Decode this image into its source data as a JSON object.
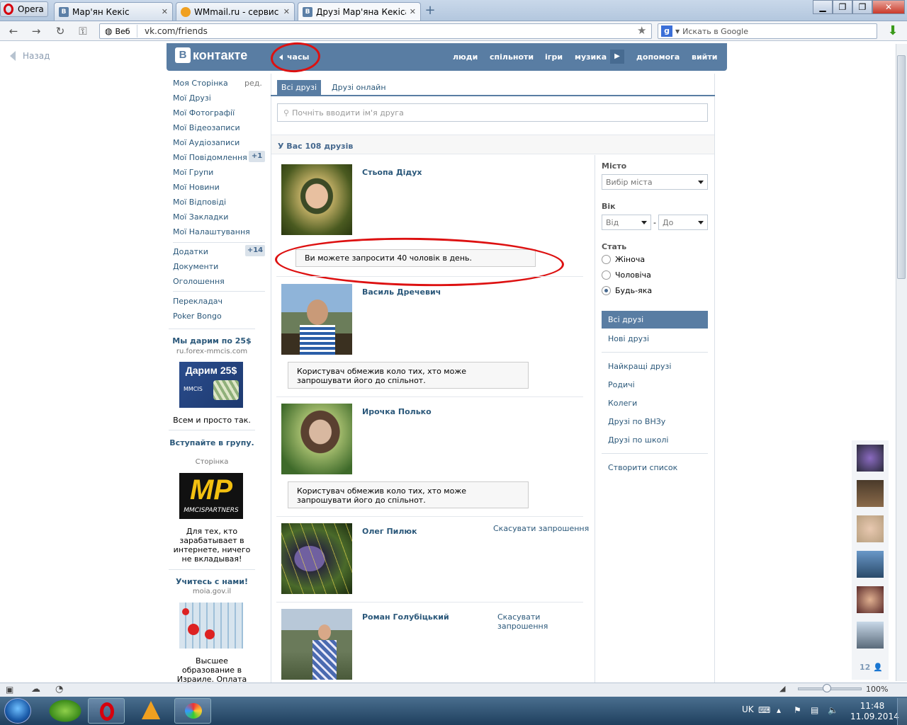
{
  "browser": {
    "menu_label": "Opera",
    "tabs": [
      {
        "label": "Мар'ян Кекіс",
        "favicon": "vk-icon"
      },
      {
        "label": "WMmail.ru - сервис п...",
        "favicon": "wmmail-icon"
      },
      {
        "label": "Друзі Мар'яна Кекіса |...",
        "favicon": "vk-icon",
        "active": true
      }
    ],
    "address_chip": "Веб",
    "url": "vk.com/friends",
    "search_placeholder": "Искать в Google",
    "zoom": "100%"
  },
  "page": {
    "back_label": "Назад",
    "logo_text": "контакте",
    "logo_letter": "В",
    "clock_label": "часы",
    "top_nav": [
      "люди",
      "спільноти",
      "ігри",
      "музика",
      "допомога",
      "вийти"
    ],
    "left_menu": [
      {
        "label": "Моя Сторінка"
      },
      {
        "label": "Мої Друзі"
      },
      {
        "label": "Мої Фотографії"
      },
      {
        "label": "Мої Відеозаписи"
      },
      {
        "label": "Мої Аудіозаписи"
      },
      {
        "label": "Мої Повідомлення",
        "badge": "+1"
      },
      {
        "label": "Мої Групи"
      },
      {
        "label": "Мої Новини"
      },
      {
        "label": "Мої Відповіді"
      },
      {
        "label": "Мої Закладки"
      },
      {
        "label": "Мої Налаштування"
      }
    ],
    "edit_label": "ред.",
    "left_menu2": [
      {
        "label": "Додатки",
        "badge": "+14"
      },
      {
        "label": "Документи"
      },
      {
        "label": "Оголошення"
      }
    ],
    "left_menu3": [
      "Перекладач",
      "Poker Bongo"
    ],
    "ads": [
      {
        "title": "Мы дарим по 25$",
        "sub": "ru.forex-mmcis.com",
        "img_text": "Дарим 25$",
        "img_sub": "MMCIS",
        "text": "Всем и просто так."
      },
      {
        "title": "Вступайте в групу.",
        "sub": "Сторінка",
        "img_text": "MP",
        "img_sub": "MMCISPARTNERS",
        "text": "Для тех, кто зарабатывает в интернете, ничего не вкладывая!"
      },
      {
        "title": "Учитесь с нами!",
        "sub": "moia.gov.il",
        "text": "Высшее образование в Израиле. Оплата обучения!"
      }
    ],
    "tabs": [
      "Всі друзі",
      "Друзі онлайн"
    ],
    "search_placeholder": "Почніть вводити ім'я друга",
    "friends_count": "У Вас 108 друзів",
    "friends": [
      {
        "name": "Стьопа Дідух",
        "notice": "Ви можете запросити 40 чоловік в день."
      },
      {
        "name": "Василь Дречевич",
        "notice": "Користувач обмежив коло тих, хто може запрошувати його до спільнот."
      },
      {
        "name": "Ирочка Полько",
        "notice": "Користувач обмежив коло тих, хто може запрошувати його до спільнот."
      },
      {
        "name": "Олег Пилюк",
        "action": "Скасувати запрошення"
      },
      {
        "name": "Роман Голубіцький",
        "action": "Скасувати запрошення"
      }
    ],
    "filters": {
      "city_label": "Місто",
      "city_value": "Вибір міста",
      "age_label": "Вік",
      "age_from": "Від",
      "age_dash": "-",
      "age_to": "До",
      "gender_label": "Стать",
      "genders": [
        "Жіноча",
        "Чоловіча",
        "Будь-яка"
      ],
      "gender_selected": "Будь-яка",
      "links_top": [
        "Всі друзі",
        "Нові друзі"
      ],
      "links_mid": [
        "Найкращі друзі",
        "Родичі",
        "Колеги",
        "Друзі по ВНЗу",
        "Друзі по школі"
      ],
      "create_list": "Створити список"
    },
    "online_count": "12"
  },
  "taskbar": {
    "lang": "UK",
    "time": "11:48",
    "date": "11.09.2014"
  },
  "colors": {
    "vk_blue": "#597da3",
    "link": "#2b587a",
    "annotation_red": "#d11111"
  }
}
